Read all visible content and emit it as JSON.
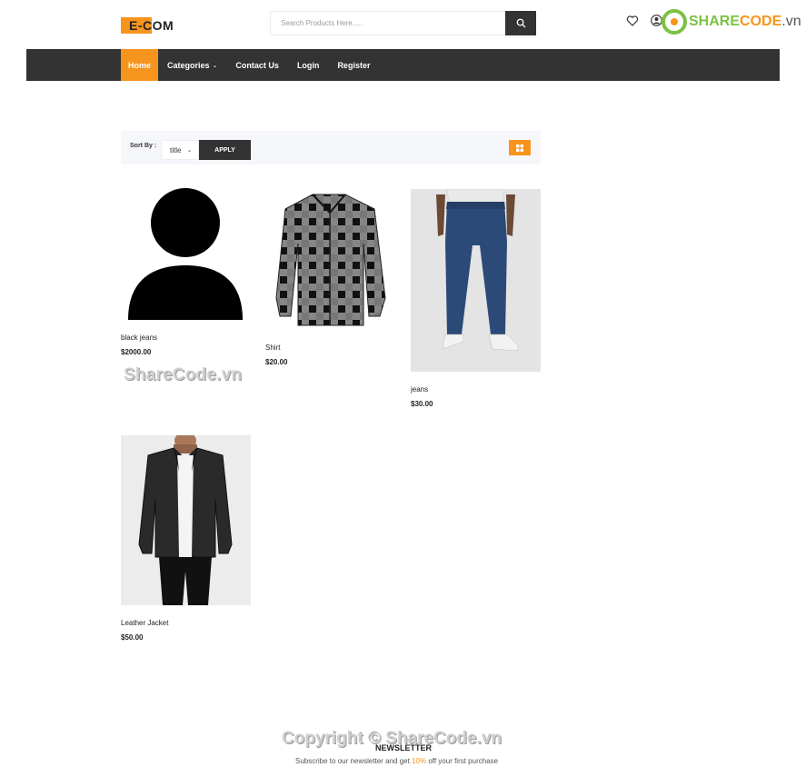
{
  "header": {
    "logo_text": "E-COM",
    "search_placeholder": "Search Products Here.....",
    "search_icon": "search-icon",
    "wishlist_icon": "heart-icon",
    "account_icon": "user-icon",
    "watermark_logo": {
      "share": "SHARE",
      "code": "CODE",
      "domain": ".vn"
    }
  },
  "nav": {
    "items": [
      {
        "label": "Home",
        "active": true
      },
      {
        "label": "Categories",
        "dropdown": true
      },
      {
        "label": "Contact Us"
      },
      {
        "label": "Login"
      },
      {
        "label": "Register"
      }
    ]
  },
  "toolbar": {
    "sort_label": "Sort By :",
    "sort_value": "title",
    "apply_label": "APPLY",
    "grid_icon": "grid-view-icon"
  },
  "products": [
    {
      "name": "black jeans",
      "price": "$2000.00",
      "image": "person-placeholder"
    },
    {
      "name": "Shirt",
      "price": "$20.00",
      "image": "plaid-shirt"
    },
    {
      "name": "jeans",
      "price": "$30.00",
      "image": "blue-jeans"
    },
    {
      "name": "Leather Jacket",
      "price": "$50.00",
      "image": "leather-jacket"
    }
  ],
  "watermarks": {
    "middle": "ShareCode.vn",
    "footer": "Copyright © ShareCode.vn"
  },
  "newsletter": {
    "title": "NEWSLETTER",
    "subtitle_before": "Subscribe to our newsletter and get ",
    "subtitle_highlight": "10%",
    "subtitle_after": " off your first purchase"
  },
  "colors": {
    "accent": "#f7941d",
    "nav_bg": "#333333",
    "toolbar_bg": "#f6f7fb"
  }
}
